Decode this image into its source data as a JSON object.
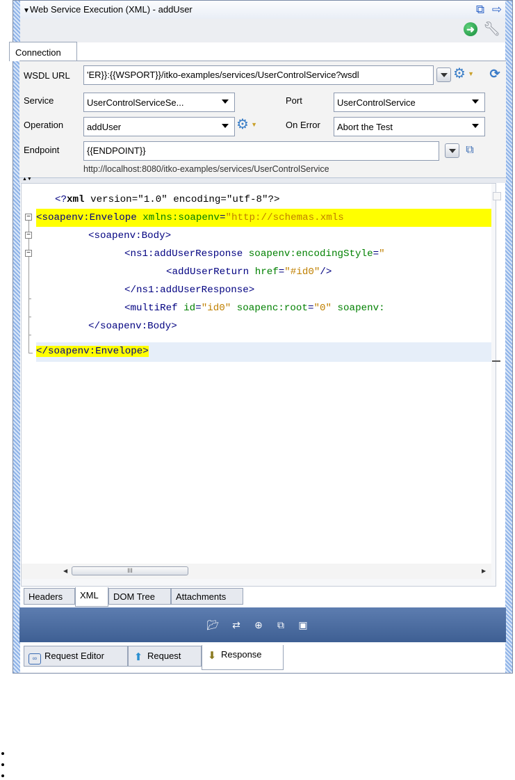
{
  "window": {
    "title": "Web Service Execution (XML) - addUser"
  },
  "icons": {
    "collapse": "triangle-down-icon",
    "detach": "detach-window-icon",
    "forward": "arrow-right-icon",
    "run": "green-arrow-icon",
    "settings": "wrench-icon"
  },
  "connection_tab": "Connection",
  "connection": {
    "wsdl_label": "WSDL URL",
    "wsdl_value": "'ER}}:{{WSPORT}}/itko-examples/services/UserControlService?wsdl",
    "service_label": "Service",
    "service_value": "UserControlServiceSe...",
    "port_label": "Port",
    "port_value": "UserControlService",
    "operation_label": "Operation",
    "operation_value": "addUser",
    "on_error_label": "On Error",
    "on_error_value": "Abort the Test",
    "endpoint_label": "Endpoint",
    "endpoint_value": "{{ENDPOINT}}",
    "endpoint_resolved": "http://localhost:8080/itko-examples/services/UserControlService"
  },
  "xml": {
    "l1": {
      "pi_open": "<?",
      "pi_name": "xml",
      "rest": " version=\"1.0\" encoding=\"utf-8\"?>"
    },
    "l2": {
      "tag": "<soapenv:Envelope",
      "attr": " xmlns:soapenv",
      "eq": "=",
      "val": "\"http://schemas.xmls"
    },
    "l3": {
      "tag": "<soapenv:Body>"
    },
    "l4": {
      "tag": "<ns1:addUserResponse",
      "attr": " soapenv:encodingStyle",
      "eq": "=",
      "val": "\""
    },
    "l5": {
      "tag": "<addUserReturn",
      "attr": " href",
      "eq": "=",
      "val": "\"#id0\"",
      "end": "/>"
    },
    "l6": {
      "tag": "</ns1:addUserResponse>"
    },
    "l7": {
      "tag": "<multiRef",
      "attr1": " id",
      "eq1": "=",
      "val1": "\"id0\"",
      "attr2": " soapenc:root",
      "eq2": "=",
      "val2": "\"0\"",
      "attr3": " soapenv:"
    },
    "l8": {
      "tag": "</soapenv:Body>"
    },
    "l9": {
      "tag": "</soapenv:Envelope>"
    }
  },
  "scrollbar": {
    "thumb_label": "III"
  },
  "view_tabs": [
    "Headers",
    "XML",
    "DOM Tree",
    "Attachments"
  ],
  "view_tabs_active": "XML",
  "bottom_tabs": [
    {
      "label": "Request Editor",
      "icon": "request-editor-icon"
    },
    {
      "label": "Request",
      "icon": "up-arrow-icon"
    },
    {
      "label": "Response",
      "icon": "down-arrow-icon"
    }
  ],
  "bottom_tabs_active": "Response",
  "colors": {
    "accent_bar": "#4a6aa0",
    "xml_tag": "#000080",
    "xml_attr": "#008000",
    "xml_value": "#c08000",
    "highlight": "#ffff00"
  }
}
